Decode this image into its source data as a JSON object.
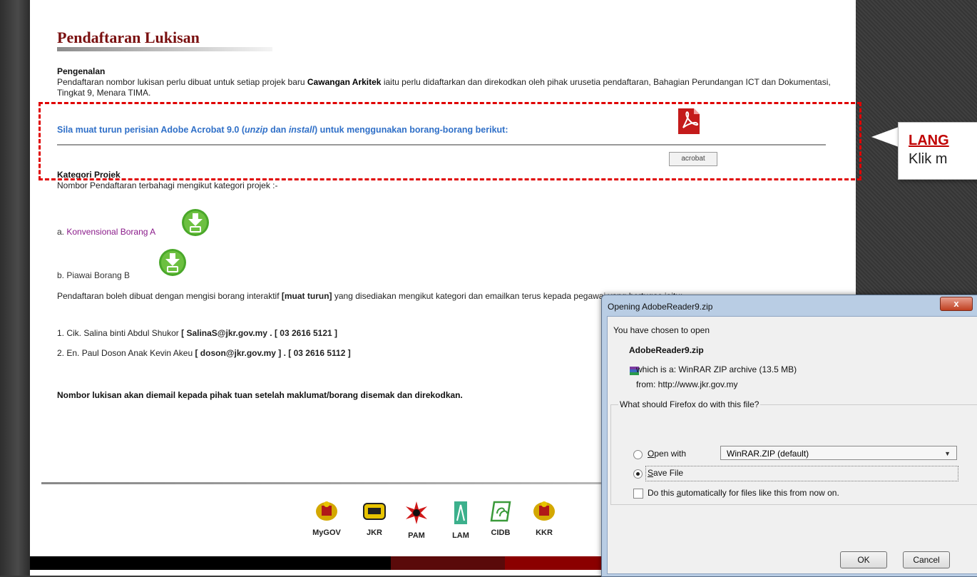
{
  "page": {
    "title": "Pendaftaran Lukisan",
    "intro": {
      "heading": "Pengenalan",
      "text_before": "Pendaftaran nombor lukisan perlu dibuat untuk setiap projek baru ",
      "text_bold": "Cawangan Arkitek",
      "text_after": " iaitu perlu didaftarkan dan direkodkan oleh  pihak urusetia pendaftaran, Bahagian Perundangan ICT dan Dokumentasi, Tingkat 9, Menara TIMA."
    },
    "acrobat": {
      "text_a": "Sila muat turun perisian Adobe Acrobat 9.0 (",
      "text_unzip": "unzip",
      "text_dan": " dan ",
      "text_install": "install",
      "text_b": ") untuk menggunakan borang-borang berikut:",
      "button_label": "acrobat",
      "icon": "pdf-icon"
    },
    "kategori": {
      "heading": "Kategori Projek",
      "text": "Nombor Pendaftaran terbahagi mengikut kategori projek :-",
      "item_a_prefix": "a. ",
      "item_a_link": "Konvensional Borang A",
      "item_b": "b. Piawai  Borang B",
      "download_icon": "download-icon"
    },
    "registration": {
      "text_before": "Pendaftaran boleh dibuat dengan mengisi borang interaktif ",
      "text_bold": "[muat turun]",
      "text_after": " yang disediakan mengikut kategori dan emailkan terus kepada pegawai yang bertugas iaitu:"
    },
    "contacts": [
      {
        "name": "1. Cik. Salina binti Abdul Shukor ",
        "detail": "[ SalinaS@jkr.gov.my . [ 03 2616 5121 ]"
      },
      {
        "name": "2. En. Paul Doson Anak Kevin Akeu ",
        "detail": "[ doson@jkr.gov.my ] . [ 03 2616 5112 ]"
      }
    ],
    "note": "Nombor lukisan akan diemail kepada pihak tuan setelah maklumat/borang disemak dan direkodkan.",
    "footer_logos": [
      "MyGOV",
      "JKR",
      "PAM",
      "LAM",
      "CIDB",
      "KKR"
    ],
    "footer_colors": [
      "#000000",
      "#5a0a0a",
      "#8b0000"
    ]
  },
  "callout": {
    "title": "LANG",
    "text": "Klik m"
  },
  "dialog": {
    "title": "Opening AdobeReader9.zip",
    "close": "x",
    "intro": "You have chosen to open",
    "filename": "AdobeReader9.zip",
    "which_is": "which is a:  WinRAR ZIP archive (13.5 MB)",
    "from": "from:  http://www.jkr.gov.my",
    "question": "What should Firefox do with this file?",
    "open_with_label_a": "O",
    "open_with_label_b": "pen with",
    "open_with_value": "WinRAR.ZIP (default)",
    "save_file_a": "S",
    "save_file_b": "ave File",
    "auto_a": "Do this ",
    "auto_u": "a",
    "auto_b": "utomatically for files like this from now on.",
    "selected_option": "save",
    "ok": "OK",
    "cancel": "Cancel"
  },
  "colors": {
    "title": "#7a1010",
    "acrobat_text": "#3070c8",
    "highlight": "#e00000",
    "link": "#8a1a8a"
  }
}
